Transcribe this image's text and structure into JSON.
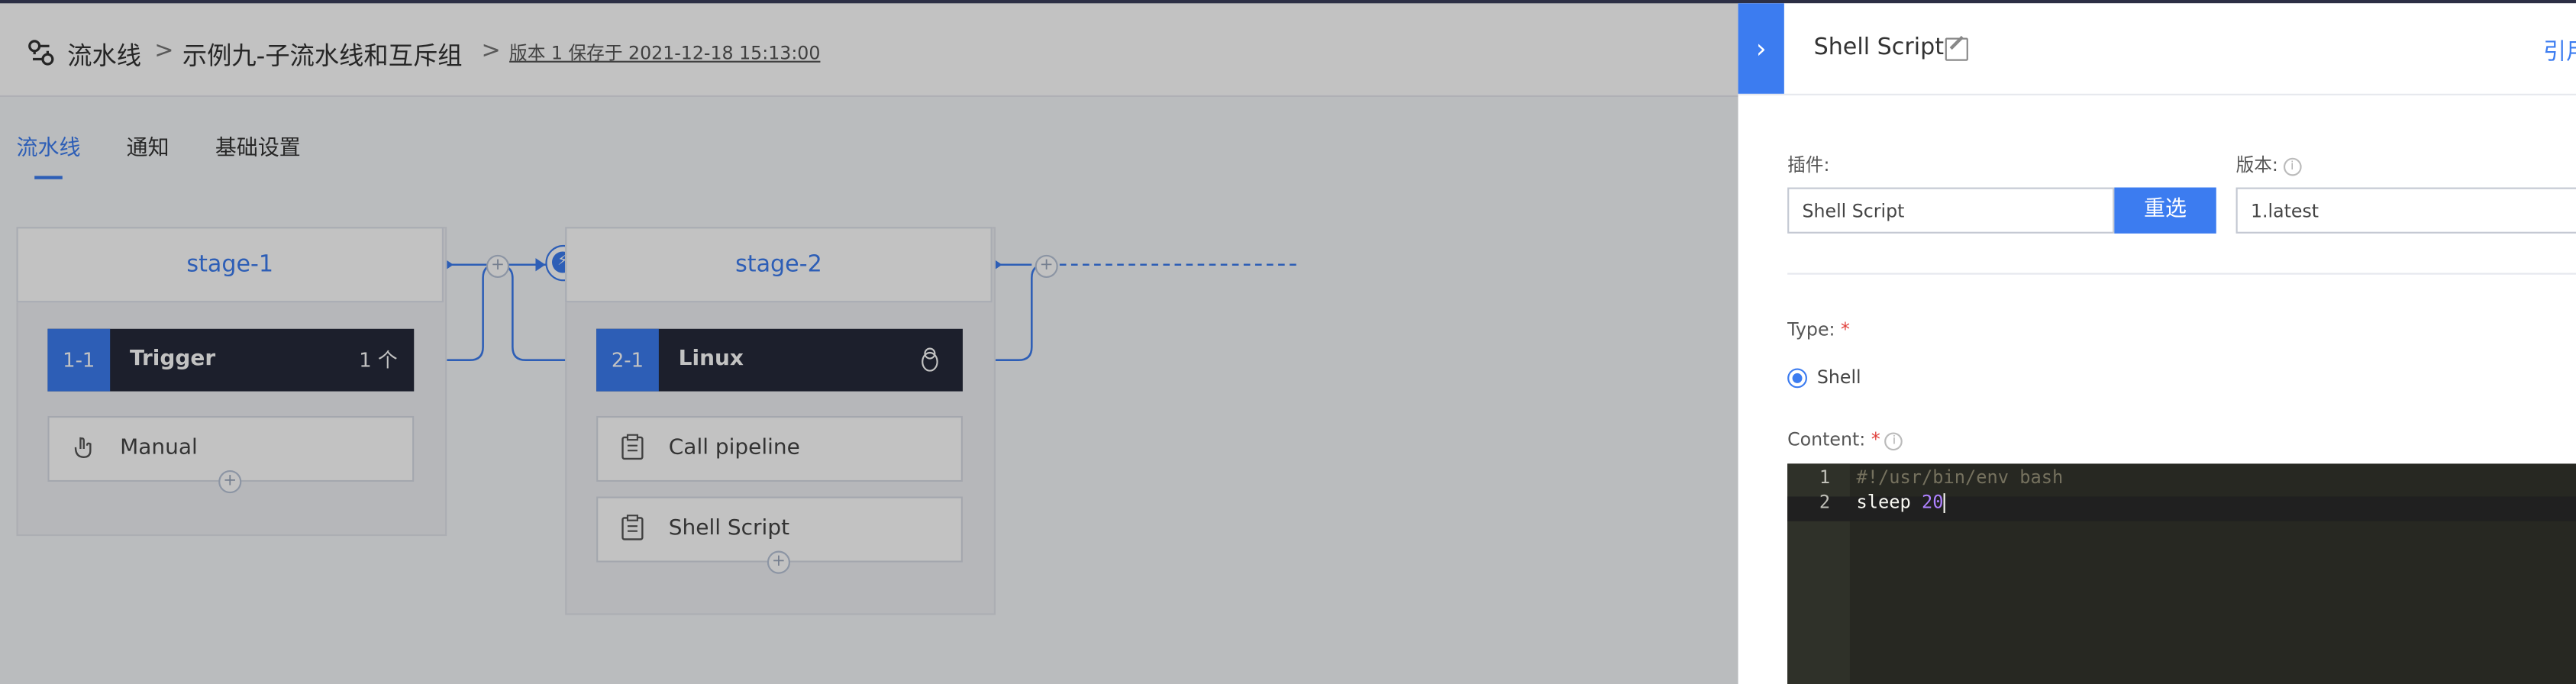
{
  "header": {
    "breadcrumb_root": "流水线",
    "breadcrumb_sep": ">",
    "pipeline_name": "示例九-子流水线和互斥组",
    "version_info": "版本 1 保存于 2021-12-18 15:13:00"
  },
  "tabs": [
    {
      "label": "流水线",
      "active": true
    },
    {
      "label": "通知",
      "active": false
    },
    {
      "label": "基础设置",
      "active": false
    }
  ],
  "stages": [
    {
      "name": "stage-1",
      "job": {
        "index": "1-1",
        "name": "Trigger",
        "extra": "1 个"
      },
      "atoms": [
        {
          "name": "Manual",
          "icon": "hand-icon"
        }
      ]
    },
    {
      "name": "stage-2",
      "job": {
        "index": "2-1",
        "name": "Linux",
        "extra_icon": "linux-penguin-icon"
      },
      "atoms": [
        {
          "name": "Call pipeline",
          "icon": "clipboard-icon"
        },
        {
          "name": "Shell Script",
          "icon": "clipboard-icon"
        }
      ]
    }
  ],
  "panel": {
    "title": "Shell Script",
    "ref_link": "引用",
    "toggle_glyph": "›",
    "plugin_label": "插件:",
    "plugin_value": "Shell Script",
    "reselect_button": "重选",
    "version_label": "版本:",
    "version_value": "1.latest",
    "type_label": "Type:",
    "type_option": "Shell",
    "content_label": "Content:",
    "required_mark": "*",
    "code_lines": [
      {
        "num": "1",
        "text": "#!/usr/bin/env bash"
      },
      {
        "num": "2",
        "keyword": "sleep ",
        "number": "20"
      }
    ]
  },
  "colors": {
    "accent": "#3c7cf0",
    "job_bg": "#252a3a",
    "editor_bg": "#272822",
    "required": "#e0413c"
  }
}
